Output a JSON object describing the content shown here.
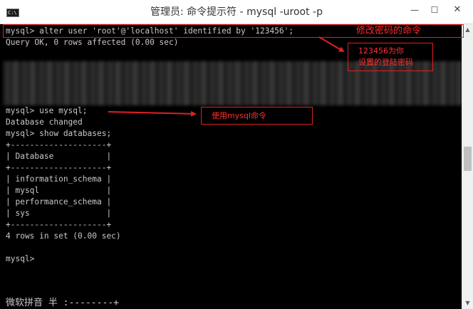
{
  "window": {
    "title": "管理员: 命令提示符 - mysql  -uroot -p",
    "icon_label": "C:\\",
    "minimize_label": "—",
    "maximize_label": "☐",
    "close_label": "✕"
  },
  "console": {
    "lines": [
      "mysql> alter user 'root'@'localhost' identified by '123456';",
      "Query OK, 0 rows affected (0.00 sec)",
      "mysql> use mysql;",
      "Database changed",
      "mysql> show databases;",
      "+--------------------+",
      "| Database           |",
      "+--------------------+",
      "| information_schema |",
      "| mysql              |",
      "| performance_schema |",
      "| sys                |",
      "+--------------------+",
      "4 rows in set (0.00 sec)",
      "mysql>"
    ],
    "ime_status": "微软拼音 半 :--------+"
  },
  "annotations": {
    "command_note": "修改密码的命令",
    "password_note_line1": "123456为你",
    "password_note_line2": "设置的登陆密码",
    "use_note": "使用mysql命令",
    "accent_color": "#e02020"
  },
  "scrollbar": {
    "up_arrow": "▲",
    "down_arrow": "▼"
  }
}
